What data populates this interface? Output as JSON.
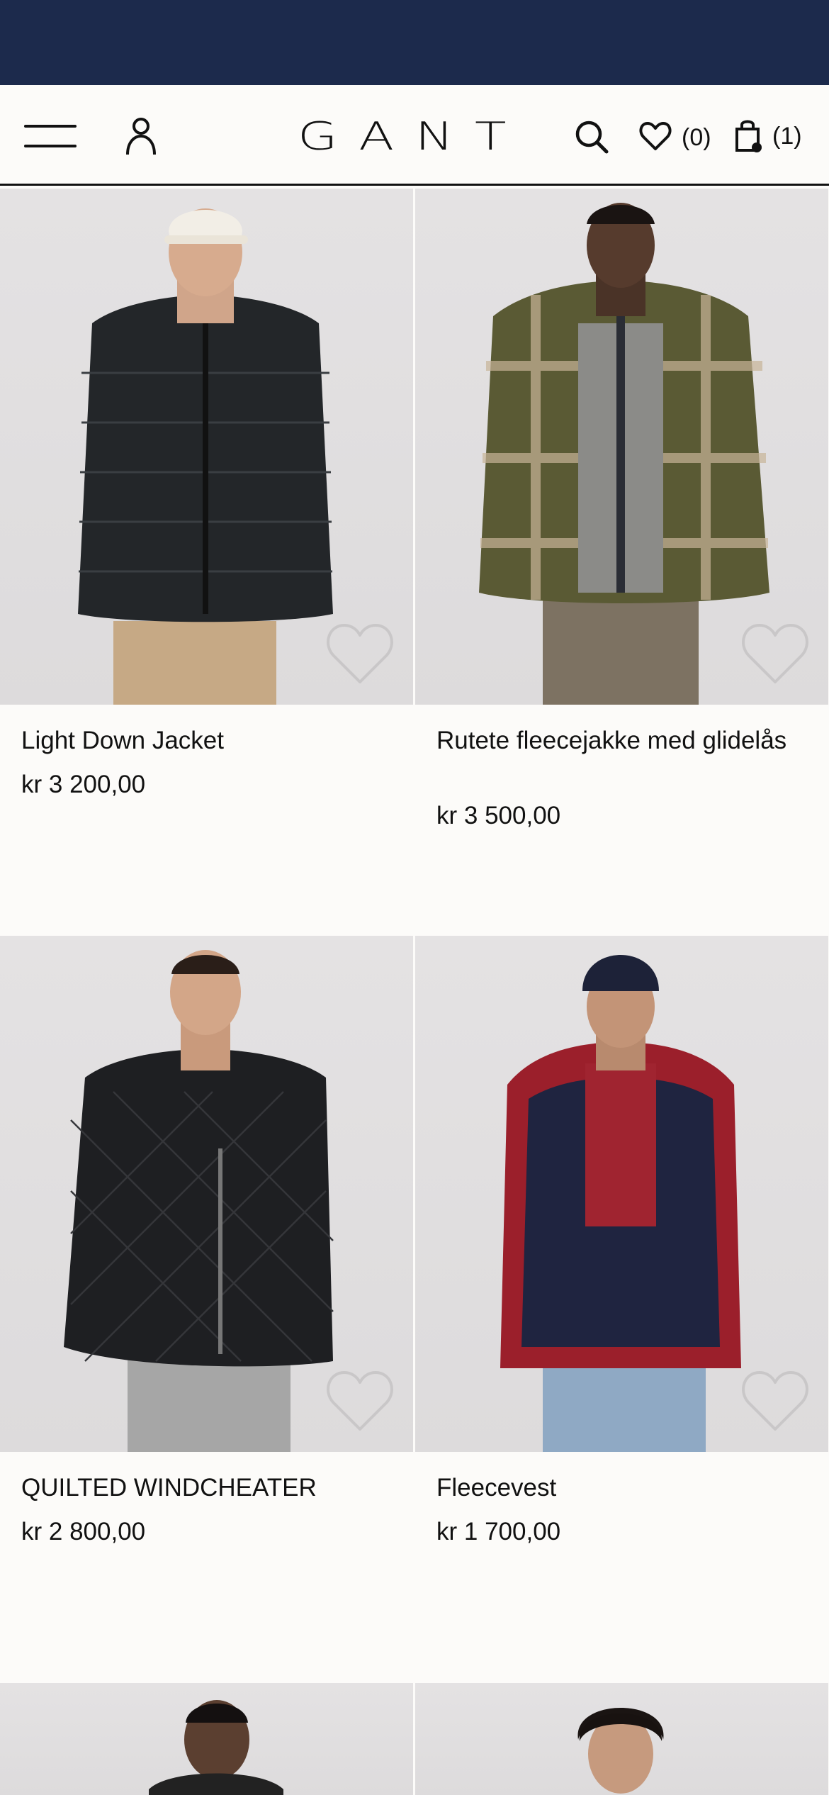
{
  "header": {
    "logo_text": "GANT",
    "wishlist_count": "(0)",
    "cart_count": "(1)"
  },
  "colors": {
    "top_band": "#1c2a4c",
    "background": "#fcfbf9",
    "photo_bg": "#e0dedf"
  },
  "products": [
    {
      "name": "Light Down Jacket",
      "price": "kr 3 200,00",
      "garment_color": "#232629",
      "pants_color": "#c6a985"
    },
    {
      "name": "Rutete fleecejakke med glidelås",
      "price": "kr 3 500,00",
      "garment_color": "#5a5a34",
      "pants_color": "#7d7262"
    },
    {
      "name": "QUILTED WINDCHEATER",
      "price": "kr 2 800,00",
      "garment_color": "#1e1f22",
      "pants_color": "#a6a6a6"
    },
    {
      "name": "Fleecevest",
      "price": "kr 1 700,00",
      "garment_color": "#1f2440",
      "pants_color": "#8fa9c4"
    }
  ]
}
